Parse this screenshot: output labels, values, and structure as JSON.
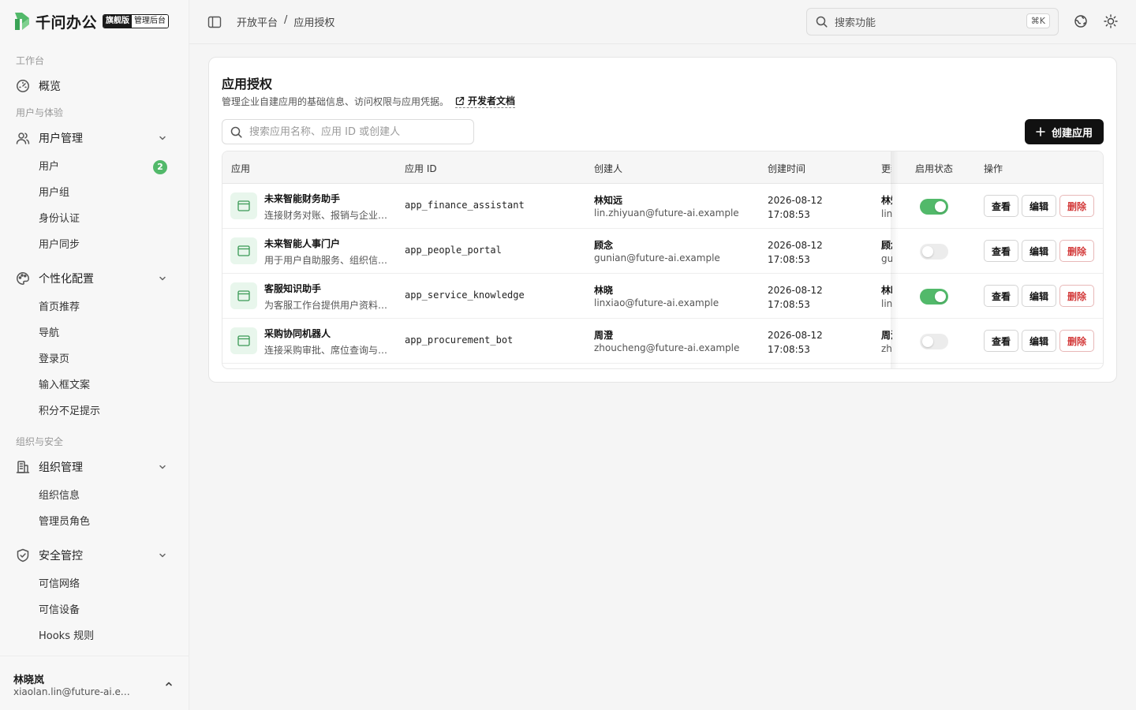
{
  "brand": {
    "name": "千问办公",
    "edition": "旗舰版",
    "console": "管理后台"
  },
  "sidebar": {
    "sections": [
      "工作台",
      "用户与体验",
      "组织与安全"
    ],
    "overview": "概览",
    "groups": [
      {
        "label": "用户管理",
        "items": [
          "用户",
          "用户组",
          "身份认证",
          "用户同步"
        ]
      },
      {
        "label": "个性化配置",
        "items": [
          "首页推荐",
          "导航",
          "登录页",
          "输入框文案",
          "积分不足提示"
        ]
      },
      {
        "label": "组织管理",
        "items": [
          "组织信息",
          "管理员角色"
        ]
      },
      {
        "label": "安全管控",
        "items": [
          "可信网络",
          "可信设备",
          "Hooks 规则"
        ]
      }
    ],
    "user_badge": "2",
    "account": {
      "name": "林晓岚",
      "email": "xiaolan.lin@future-ai.example"
    }
  },
  "topbar": {
    "breadcrumb": [
      "开放平台",
      "/",
      "应用授权"
    ],
    "search_label": "搜索功能",
    "shortcut": "⌘K"
  },
  "page": {
    "title": "应用授权",
    "description": "管理企业自建应用的基础信息、访问权限与应用凭据。",
    "doc_link": "开发者文档",
    "search_placeholder": "搜索应用名称、应用 ID 或创建人",
    "create_button": "创建应用"
  },
  "table": {
    "columns": [
      "应用",
      "应用 ID",
      "创建人",
      "创建时间",
      "更新人",
      "启用状态",
      "操作"
    ],
    "actions": {
      "view": "查看",
      "edit": "编辑",
      "delete": "删除"
    },
    "rows": [
      {
        "name": "未来智能财务助手",
        "desc": "连接财务对账、报销与企业…",
        "id": "app_finance_assistant",
        "creator": "林知远",
        "email": "lin.zhiyuan@future-ai.example",
        "date": "2026-08-12",
        "time": "17:08:53",
        "updater": "林知远",
        "updater_email": "lin.zhiyuan@future-ai.example",
        "enabled": true
      },
      {
        "name": "未来智能人事门户",
        "desc": "用于用户自助服务、组织信…",
        "id": "app_people_portal",
        "creator": "顾念",
        "email": "gunian@future-ai.example",
        "date": "2026-08-12",
        "time": "17:08:53",
        "updater": "顾念",
        "updater_email": "gunian@future-ai.example",
        "enabled": false
      },
      {
        "name": "客服知识助手",
        "desc": "为客服工作台提供用户资料…",
        "id": "app_service_knowledge",
        "creator": "林晓",
        "email": "linxiao@future-ai.example",
        "date": "2026-08-12",
        "time": "17:08:53",
        "updater": "林晓",
        "updater_email": "linxiao@future-ai.example",
        "enabled": true
      },
      {
        "name": "采购协同机器人",
        "desc": "连接采购审批、席位查询与…",
        "id": "app_procurement_bot",
        "creator": "周澄",
        "email": "zhoucheng@future-ai.example",
        "date": "2026-08-12",
        "time": "17:08:53",
        "updater": "周澄",
        "updater_email": "zhoucheng@future-ai.example",
        "enabled": false
      }
    ]
  },
  "colors": {
    "accent": "#52b96a",
    "primary_button": "#111111",
    "danger": "#d33a3a"
  },
  "icons": [
    "brand-logo-icon",
    "dashboard-icon",
    "users-icon",
    "palette-icon",
    "building-icon",
    "shield-icon",
    "chevron-down-icon",
    "chevron-up-icon",
    "sidebar-toggle-icon",
    "search-icon",
    "globe-icon",
    "sun-icon",
    "external-link-icon",
    "plus-icon",
    "app-window-icon"
  ]
}
